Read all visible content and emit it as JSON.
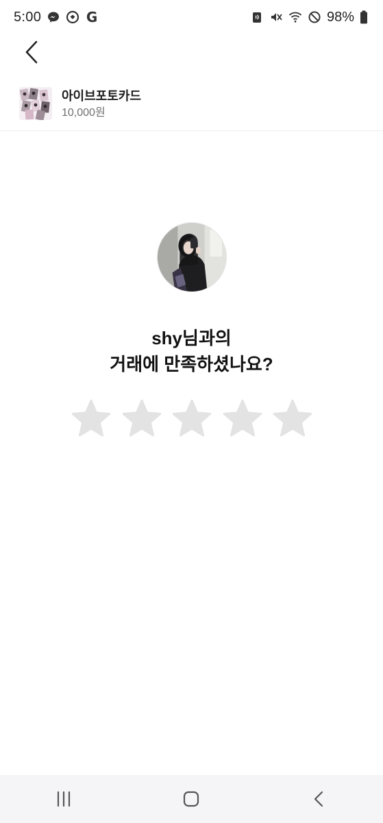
{
  "status_bar": {
    "time": "5:00",
    "battery": "98%",
    "left_icons": [
      "messenger-icon",
      "chat-icon",
      "google-icon"
    ],
    "google_letter": "G",
    "right_icons": [
      "nfc-icon",
      "mute-icon",
      "wifi-icon",
      "do-not-disturb-icon",
      "battery-icon"
    ]
  },
  "header": {
    "back_icon": "chevron-left-icon"
  },
  "product": {
    "title": "아이브포토카드",
    "price": "10,000원"
  },
  "review": {
    "line1": "shy님과의",
    "line2": "거래에 만족하셨나요?",
    "rating": 0,
    "max_rating": 5,
    "star_color_empty": "#e3e3e3"
  },
  "nav_bar": {
    "buttons": [
      "recent-apps-icon",
      "home-icon",
      "back-icon"
    ]
  }
}
